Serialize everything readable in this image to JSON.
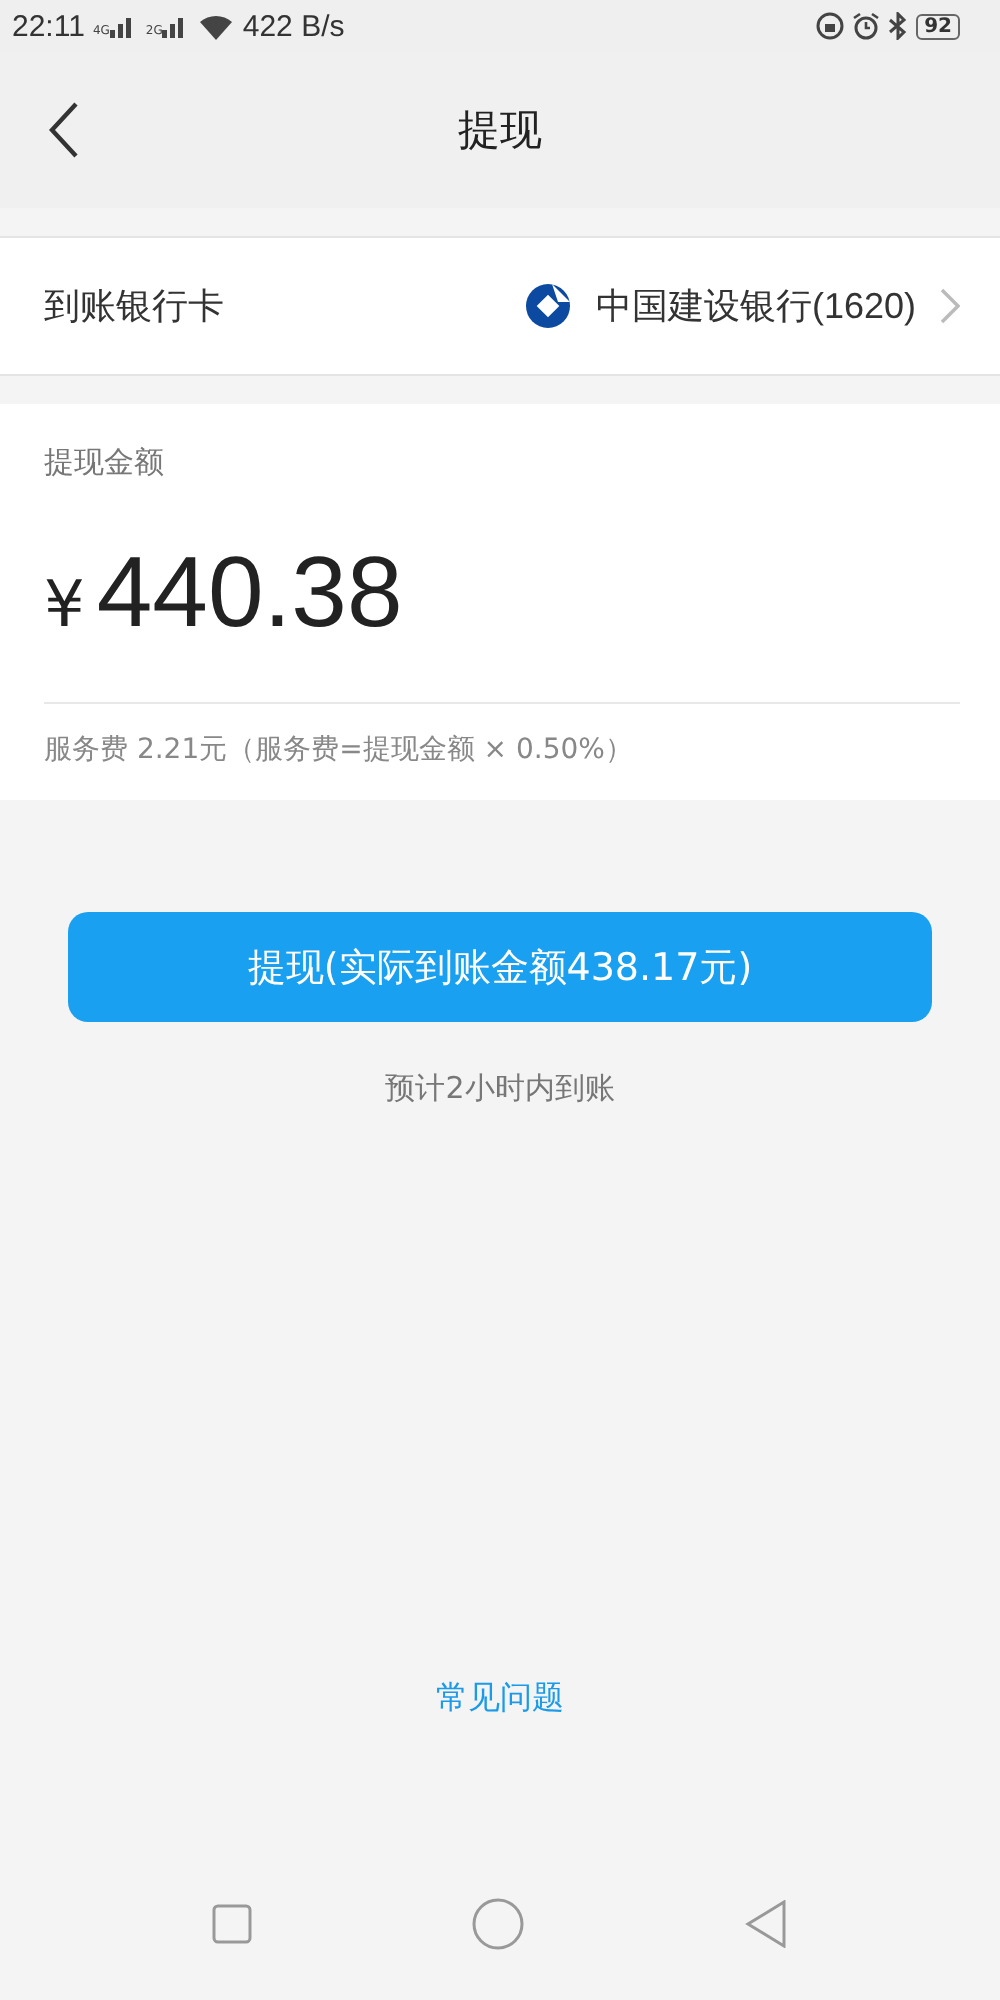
{
  "status_bar": {
    "time": "22:11",
    "sim_1": "4G",
    "sim_2": "2G",
    "speed": "422 B/s",
    "battery": "92"
  },
  "header": {
    "title": "提现"
  },
  "bank_card": {
    "label": "到账银行卡",
    "bank": "中国建设银行(1620)"
  },
  "amount": {
    "label": "提现金额",
    "currency": "¥",
    "value": "440.38",
    "fee_note": "服务费 2.21元（服务费=提现金额 × 0.50%）"
  },
  "withdraw_button": {
    "label": "提现(实际到账金额438.17元)"
  },
  "eta_note": "预计2小时内到账",
  "faq_link": "常见问题"
}
